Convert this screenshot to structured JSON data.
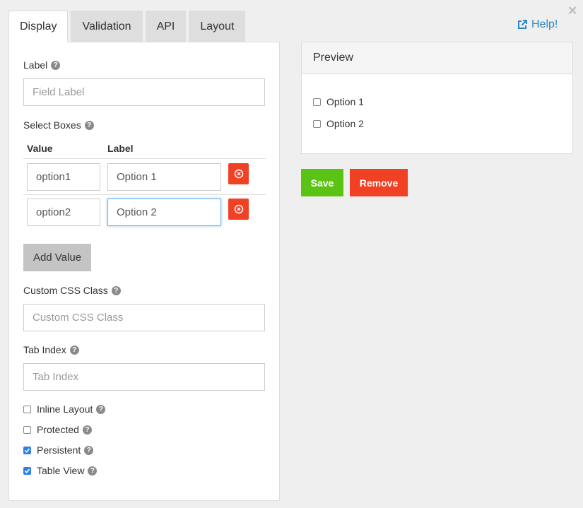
{
  "tabs": [
    {
      "label": "Display"
    },
    {
      "label": "Validation"
    },
    {
      "label": "API"
    },
    {
      "label": "Layout"
    }
  ],
  "help": {
    "label": "Help!"
  },
  "display": {
    "label_field": {
      "title": "Label",
      "placeholder": "Field Label",
      "value": ""
    },
    "select_boxes": {
      "title": "Select Boxes",
      "columns": {
        "value": "Value",
        "label": "Label"
      },
      "rows": [
        {
          "value": "option1",
          "label": "Option 1"
        },
        {
          "value": "option2",
          "label": "Option 2"
        }
      ],
      "add_button": "Add Value"
    },
    "custom_css": {
      "title": "Custom CSS Class",
      "placeholder": "Custom CSS Class"
    },
    "tab_index": {
      "title": "Tab Index",
      "placeholder": "Tab Index"
    },
    "checkboxes": [
      {
        "label": "Inline Layout",
        "checked": false
      },
      {
        "label": "Protected",
        "checked": false
      },
      {
        "label": "Persistent",
        "checked": true
      },
      {
        "label": "Table View",
        "checked": true
      }
    ]
  },
  "preview": {
    "title": "Preview",
    "options": [
      {
        "label": "Option 1",
        "checked": false
      },
      {
        "label": "Option 2",
        "checked": false
      }
    ]
  },
  "actions": {
    "save": "Save",
    "remove": "Remove"
  },
  "colors": {
    "save": "#5bc313",
    "remove": "#f04124",
    "link": "#2a87c5",
    "checked": "#2f80ed"
  }
}
